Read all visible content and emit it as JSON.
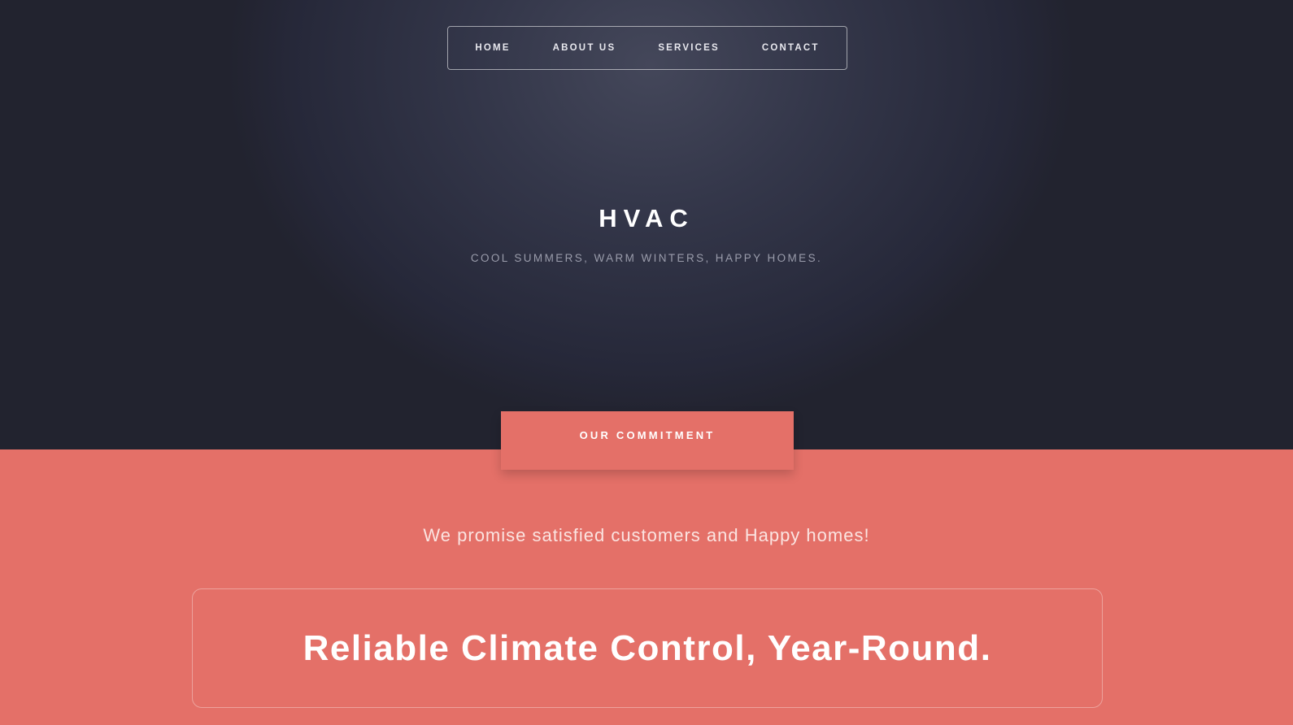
{
  "nav": {
    "items": [
      {
        "label": "HOME"
      },
      {
        "label": "ABOUT US"
      },
      {
        "label": "SERVICES"
      },
      {
        "label": "CONTACT"
      }
    ]
  },
  "hero": {
    "title": "HVAC",
    "tagline": "COOL SUMMERS, WARM WINTERS, HAPPY HOMES."
  },
  "commitment": {
    "tab_label": "OUR COMMITMENT",
    "promise": "We promise satisfied customers and Happy homes!",
    "headline": "Reliable Climate Control, Year-Round."
  },
  "colors": {
    "hero_bg": "#262839",
    "accent": "#e47068",
    "text_light": "#ffffff",
    "tagline_text": "#9a9cab"
  }
}
